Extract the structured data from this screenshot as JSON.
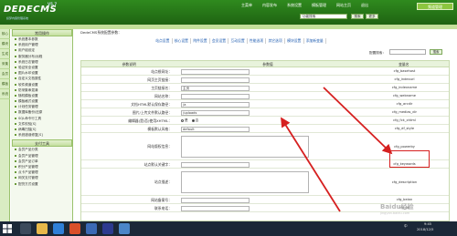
{
  "header": {
    "logo": "DEDECMS",
    "version": "V5.7",
    "logo_sub": "织梦内容管理系统",
    "nav": [
      "主菜单",
      "内容发布",
      "系统设置",
      "模板管理",
      "网站主页",
      "退出"
    ],
    "user_label": "频道管理",
    "search_value": "功能搜索",
    "search_button": "搜索",
    "extra_button": "更多"
  },
  "iconbar": [
    "核心",
    "模块",
    "生成",
    "采集",
    "会员",
    "模板",
    "系统"
  ],
  "menu": {
    "section1": "常用操作",
    "items1": [
      "系统基本参数",
      "系统用户管理",
      "用户组设定",
      "服务器分布/远程",
      "系统日志管理",
      "验证安全设置",
      "图片水印设置",
      "自定义文档属性",
      "软件频道设置",
      "防采集串混淆",
      "随机模板设置",
      "模板格式设置",
      "计划任务管理",
      "数据库备份/还原",
      "SQL命令行工具",
      "文件校验[S]",
      "病毒扫描[S]",
      "系统错误修复[S]"
    ],
    "section2": "支付工具",
    "items2": [
      "会员产品分类",
      "会员产品管理",
      "会员产品订单",
      "积分产品管理",
      "点卡产品管理",
      "网关支付管理",
      "配货方式设置"
    ]
  },
  "content": {
    "crumb": "DedeCMS系统配置参数：",
    "tabs": [
      "站点设置",
      "核心设置",
      "附件设置",
      "会员设置",
      "互动设置",
      "性能选项",
      "其它选项",
      "模块设置",
      "添加新变量"
    ],
    "filter_label": "配置搜索：",
    "filter_button": "搜索",
    "col_label": "参数说明",
    "col_value": "参数值",
    "col_var": "变量名",
    "rows": [
      {
        "label": "站点根网址：",
        "value": "",
        "var": "cfg_basehost",
        "type": "input"
      },
      {
        "label": "网页主页链接：",
        "value": "",
        "var": "cfg_indexurl",
        "type": "input"
      },
      {
        "label": "主页链接名：",
        "value": "主页",
        "var": "cfg_indexname",
        "type": "input"
      },
      {
        "label": "网站名称：",
        "value": "",
        "var": "cfg_webname",
        "type": "input"
      },
      {
        "label": "文档HTML默认保存路径：",
        "value": "/a",
        "var": "cfg_arcdir",
        "type": "input"
      },
      {
        "label": "图片/上传文件默认路径：",
        "value": "/uploads",
        "var": "cfg_medias_dir",
        "type": "input"
      },
      {
        "label": "编辑器(是/否)使用XHTML：",
        "opt_yes": "是",
        "opt_no": "否",
        "var": "cfg_fck_xhtml",
        "type": "radio"
      },
      {
        "label": "模板默认风格：",
        "value": "default",
        "var": "cfg_df_style",
        "type": "input"
      },
      {
        "label": "网站版权信息：",
        "value": "",
        "var": "cfg_powerby",
        "type": "textarea"
      },
      {
        "label": "站点默认关键字：",
        "value": "",
        "var": "cfg_keywords",
        "type": "input"
      },
      {
        "label": "站点描述：",
        "value": "",
        "var": "cfg_description",
        "type": "textarea"
      },
      {
        "label": "网站备案号：",
        "value": "",
        "var": "cfg_beian",
        "type": "input"
      },
      {
        "label": "联系电话：",
        "value": "",
        "var": "cfg_tel",
        "type": "input"
      }
    ]
  },
  "taskbar": {
    "time": "9:45",
    "date": "2018/12/5",
    "lang": "中"
  },
  "watermark": {
    "main": "Baidu经验",
    "sub": "jingyan.baidu.com"
  },
  "colors": {
    "header_green": "#2f8a1e",
    "highlight_red": "#d62020"
  }
}
